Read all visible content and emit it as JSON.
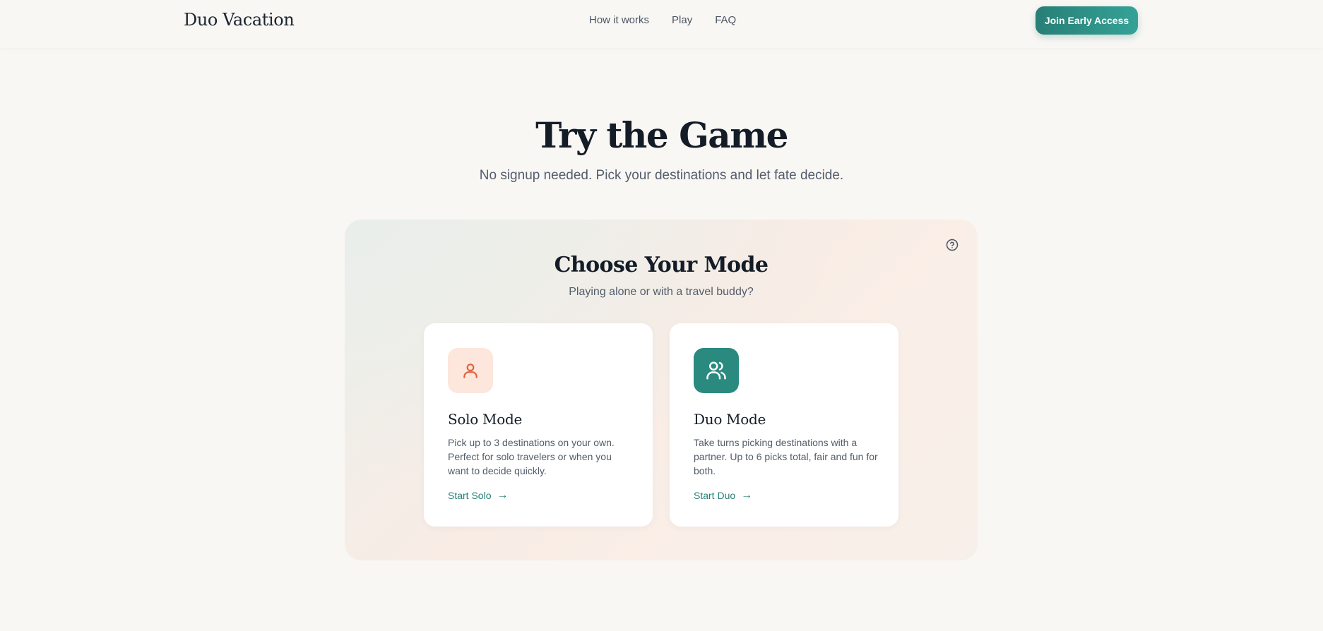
{
  "header": {
    "brand": "Duo Vacation",
    "nav": [
      "How it works",
      "Play",
      "FAQ"
    ],
    "cta_label": "Join Early Access"
  },
  "hero": {
    "title": "Try the Game",
    "subtitle": "No signup needed. Pick your destinations and let fate decide."
  },
  "mode_panel": {
    "title": "Choose Your Mode",
    "subtitle": "Playing alone or with a travel buddy?",
    "help_icon": "help-circle-icon",
    "cards": [
      {
        "icon": "user-icon",
        "title": "Solo Mode",
        "description": "Pick up to 3 destinations on your own. Perfect for solo travelers or when you want to decide quickly.",
        "link_label": "Start Solo",
        "link_arrow": "→"
      },
      {
        "icon": "users-icon",
        "title": "Duo Mode",
        "description": "Take turns picking destinations with a partner. Up to 6 picks total, fair and fun for both.",
        "link_label": "Start Duo",
        "link_arrow": "→"
      }
    ]
  },
  "colors": {
    "accent": "#277f76",
    "accent_light": "#35a297",
    "solo_icon_bg": "#fde6dc",
    "solo_icon_fg": "#e0623c",
    "background": "#f9f7f4"
  }
}
